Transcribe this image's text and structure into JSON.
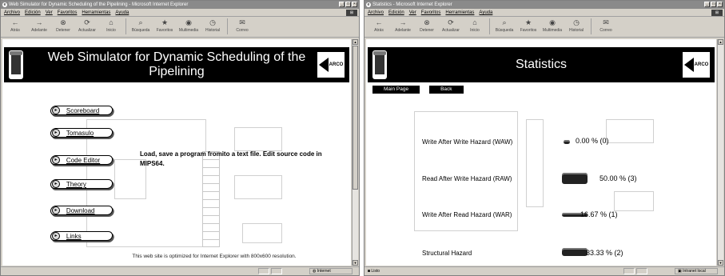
{
  "left_window": {
    "title": "Web Simulator for Dynamic Scheduling of the Pipelining - Microsoft Internet Explorer",
    "menu": [
      "Archivo",
      "Edición",
      "Ver",
      "Favoritos",
      "Herramientas",
      "Ayuda"
    ],
    "toolbar": [
      "Atrás",
      "Adelante",
      "Detener",
      "Actualizar",
      "Inicio",
      "Búsqueda",
      "Favoritos",
      "Multimedia",
      "Historial",
      "Correo"
    ],
    "banner_title": "Web Simulator for Dynamic Scheduling of the Pipelining",
    "nav": [
      "Scoreboard",
      "Tomasulo",
      "Code Editor",
      "Theory",
      "Download",
      "Links"
    ],
    "description": "Load, save a program fromito a text file. Edit source code in MIPS64.",
    "footnote": "This web site is optimized for Internet Explorer with 800x600 resolution.",
    "status_zone": "Internet",
    "logo_right": "ARCO"
  },
  "right_window": {
    "title": "Statistics - Microsoft Internet Explorer",
    "menu": [
      "Archivo",
      "Edición",
      "Ver",
      "Favoritos",
      "Herramientas",
      "Ayuda"
    ],
    "toolbar": [
      "Atrás",
      "Adelante",
      "Detener",
      "Actualizar",
      "Inicio",
      "Búsqueda",
      "Favoritos",
      "Multimedia",
      "Historial",
      "Correo"
    ],
    "banner_title": "Statistics",
    "buttons": [
      "Main Page",
      "Back"
    ],
    "hazards": [
      {
        "label": "Write After Write Hazard (WAW)",
        "value": "0.00 % (0)",
        "percent": 0.0
      },
      {
        "label": "Read After Write Hazard (RAW)",
        "value": "50.00 % (3)",
        "percent": 50.0
      },
      {
        "label": "Write After Read Hazard (WAR)",
        "value": "16.67 % (1)",
        "percent": 16.67
      },
      {
        "label": "Structural Hazard",
        "value": "33.33 % (2)",
        "percent": 33.33
      }
    ],
    "status_left": "Listo",
    "status_zone": "Intranet local",
    "logo_right": "ARCO"
  }
}
